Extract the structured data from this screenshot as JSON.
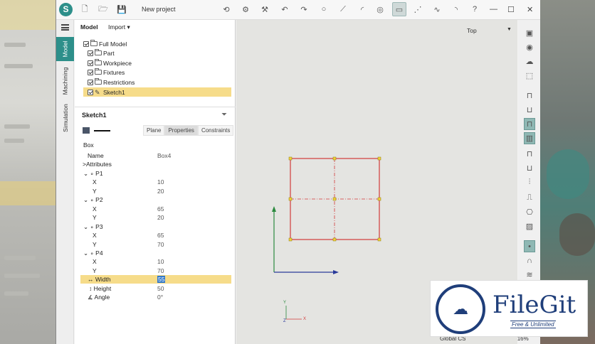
{
  "app": {
    "logo_letter": "S",
    "project_title": "New project"
  },
  "rail": {
    "tabs": [
      "Model",
      "Machining",
      "Simulation"
    ]
  },
  "panel": {
    "header_model": "Model",
    "header_import": "Import",
    "tree": [
      {
        "label": "Full Model",
        "icon": "folder-icon"
      },
      {
        "label": "Part",
        "icon": "folder-icon"
      },
      {
        "label": "Workpiece",
        "icon": "folder-icon"
      },
      {
        "label": "Fixtures",
        "icon": "folder-icon"
      },
      {
        "label": "Restrictions",
        "icon": "folder-icon"
      },
      {
        "label": "Sketch1",
        "icon": "sketch-icon",
        "selected": true
      }
    ],
    "sketch_title": "Sketch1",
    "tabs": [
      "Plane",
      "Properties",
      "Constraints"
    ],
    "active_tab": "Properties",
    "section": "Box",
    "props": [
      {
        "key": "Name",
        "value": "Box4"
      },
      {
        "key": ">Attributes",
        "value": ""
      },
      {
        "key": "P1",
        "value": ""
      },
      {
        "key": "X",
        "value": "10"
      },
      {
        "key": "Y",
        "value": "20"
      },
      {
        "key": "P2",
        "value": ""
      },
      {
        "key": "X",
        "value": "65"
      },
      {
        "key": "Y",
        "value": "20"
      },
      {
        "key": "P3",
        "value": ""
      },
      {
        "key": "X",
        "value": "65"
      },
      {
        "key": "Y",
        "value": "70"
      },
      {
        "key": "P4",
        "value": ""
      },
      {
        "key": "X",
        "value": "10"
      },
      {
        "key": "Y",
        "value": "70"
      },
      {
        "key": "Width",
        "value": "55"
      },
      {
        "key": "Height",
        "value": "50"
      },
      {
        "key": "Angle",
        "value": "0°"
      }
    ]
  },
  "viewport": {
    "view_name": "Top",
    "axis_labels": [
      "Y",
      "Z",
      "X"
    ]
  },
  "watermark": {
    "title": "FileGit",
    "subtitle": "Free & Unlimited"
  },
  "status": {
    "cs": "Global CS",
    "zoom": "16%"
  },
  "colors": {
    "accent": "#2d8f8a",
    "selection": "#f6dc8a",
    "sketch_line": "#d23a3a"
  }
}
